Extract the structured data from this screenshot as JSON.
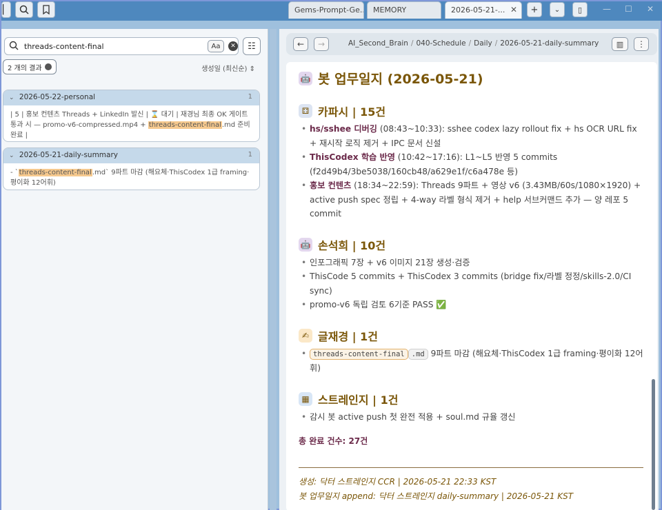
{
  "tabs": [
    {
      "label": "Gems-Prompt-Ge..."
    },
    {
      "label": "MEMORY"
    },
    {
      "label": "2026-05-21-..."
    }
  ],
  "search": {
    "value": "threads-content-final",
    "case_label": "Aa",
    "result_count": "2 개의 결과",
    "sort_label": "생성일 (최신순)"
  },
  "results": [
    {
      "file": "2026-05-22-personal",
      "count": "1",
      "before": "| 5 | 홍보 컨텐츠 Threads + LinkedIn 발신 | ⌛ 대기 | 재경님 최종 OK 게이트 통과 시 — promo-v6-compressed.mp4 + ",
      "match": "threads-content-final",
      "after": ".md 준비 완료 |"
    },
    {
      "file": "2026-05-21-daily-summary",
      "count": "1",
      "before": "- `",
      "match": "threads-content-final",
      "after": ".md` 9파트 마감 (해요체·ThisCodex 1급 framing·평이화 12어휘)"
    }
  ],
  "breadcrumb": [
    "AI_Second_Brain",
    "040-Schedule",
    "Daily",
    "2026-05-21-daily-summary"
  ],
  "note": {
    "title": "봇 업무일지 (2026-05-21)",
    "sections": [
      {
        "heading": "카파시 | 15건",
        "items": [
          {
            "bold": "hs/sshee 디버깅",
            "text": " (08:43~10:33): sshee codex lazy rollout fix + hs OCR URL fix + 재시작 로직 제거 + IPC 문서 신설"
          },
          {
            "bold": "ThisCodex 학습 반영",
            "text": " (10:42~17:16): L1~L5 반영 5 commits (f2d49b4/3be5038/160cb48/a629e1f/c6a478e 등)"
          },
          {
            "bold": "홍보 컨텐츠",
            "text": " (18:34~22:59): Threads 9파트 + 영상 v6 (3.43MB/60s/1080×1920) + active push spec 정립 + 4-way 라벨 형식 제거 + help 서브커맨드 추가 — 양 레포 5 commit"
          }
        ]
      },
      {
        "heading": "손석희 | 10건",
        "items": [
          {
            "text": "인포그래픽 7장 + v6 이미지 21장 생성·검증"
          },
          {
            "text": "ThisCode 5 commits + ThisCodex 3 commits (bridge fix/라벨 정정/skills-2.0/CI sync)"
          },
          {
            "text": "promo-v6 독립 검토 6기준 PASS ✅"
          }
        ]
      },
      {
        "heading": "글재경 | 1건",
        "code1": "threads-content-final",
        "code2": ".md",
        "tail": " 9파트 마감 (해요체·ThisCodex 1급 framing·평이화 12어휘)"
      },
      {
        "heading": "스트레인지 | 1건",
        "items": [
          {
            "text": "감시 봇 active push 첫 완전 적용 + soul.md 규율 갱신"
          }
        ]
      }
    ],
    "total": "총 완료 건수: 27건",
    "footer1": "생성: 닥터 스트레인지 CCR | 2026-05-21 22:33 KST",
    "footer2": "봇 업무일지 append: 닥터 스트레인지 daily-summary | 2026-05-21 KST"
  },
  "colors": {
    "accent": "#7a5608",
    "highlight": "#f6c98e",
    "titlebar": "#4e88be"
  }
}
